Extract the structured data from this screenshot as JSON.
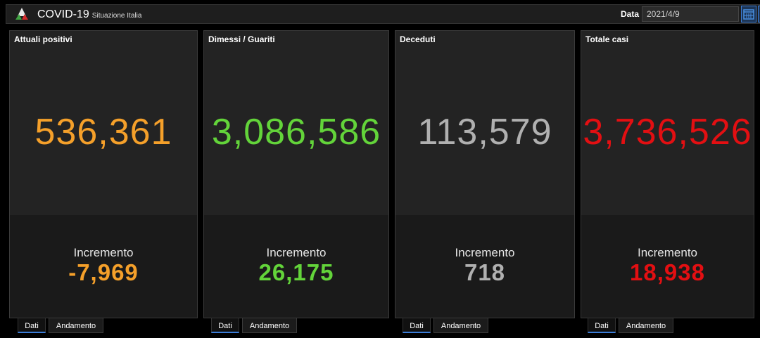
{
  "header": {
    "title": "COVID-19",
    "subtitle": "Situazione Italia",
    "date_label": "Data",
    "date_value": "2021/4/9"
  },
  "cards": [
    {
      "title": "Attuali positivi",
      "value": "536,361",
      "increment_label": "Incremento",
      "increment": "-7,969",
      "color": "#f5a02a"
    },
    {
      "title": "Dimessi / Guariti",
      "value": "3,086,586",
      "increment_label": "Incremento",
      "increment": "26,175",
      "color": "#63d43a"
    },
    {
      "title": "Deceduti",
      "value": "113,579",
      "increment_label": "Incremento",
      "increment": "718",
      "color": "#b0b0b0"
    },
    {
      "title": "Totale casi",
      "value": "3,736,526",
      "increment_label": "Incremento",
      "increment": "18,938",
      "color": "#e30f12"
    }
  ],
  "tabs": [
    {
      "dati": "Dati",
      "andamento": "Andamento"
    },
    {
      "dati": "Dati",
      "andamento": "Andamento"
    },
    {
      "dati": "Dati",
      "andamento": "Andamento"
    },
    {
      "dati": "Dati",
      "andamento": "Andamento"
    }
  ]
}
